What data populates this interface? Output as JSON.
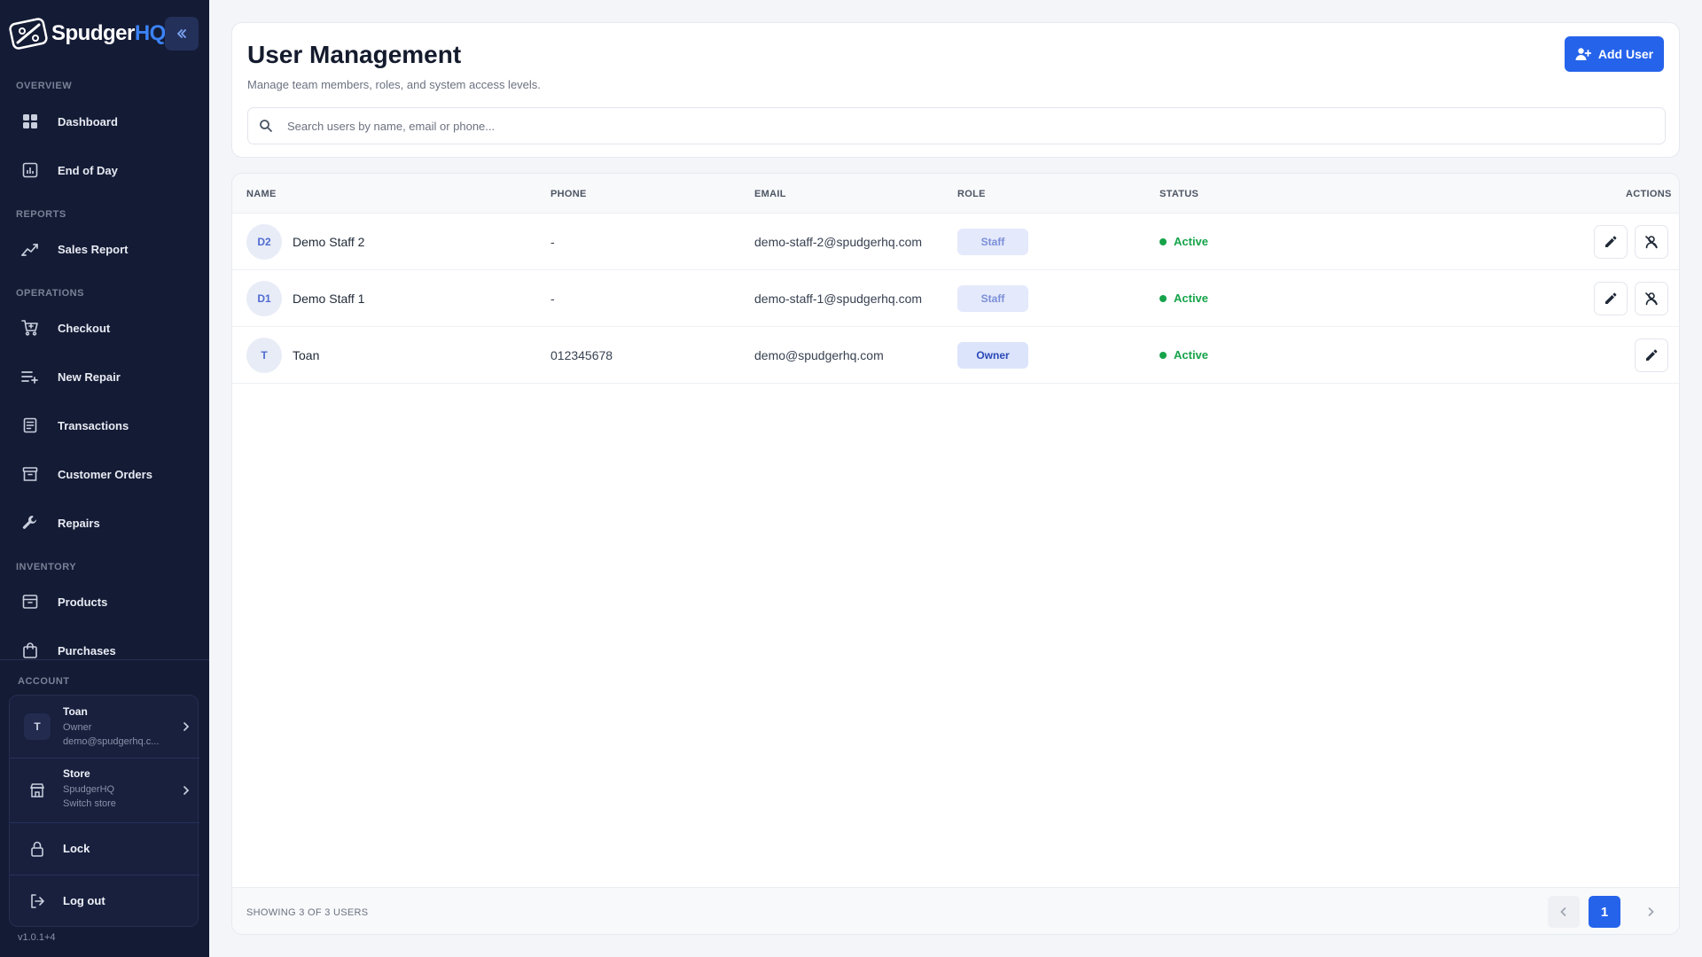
{
  "brand": {
    "name_part1": "Spudger",
    "name_part2": "HQ"
  },
  "sidebar": {
    "sections": {
      "overview": "OVERVIEW",
      "reports": "REPORTS",
      "operations": "OPERATIONS",
      "inventory": "INVENTORY",
      "account": "ACCOUNT"
    },
    "items": [
      {
        "label": "Dashboard",
        "icon": "grid-icon"
      },
      {
        "label": "End of Day",
        "icon": "bar-chart-icon"
      },
      {
        "label": "Sales Report",
        "icon": "trend-icon"
      },
      {
        "label": "Checkout",
        "icon": "cart-icon"
      },
      {
        "label": "New Repair",
        "icon": "list-add-icon"
      },
      {
        "label": "Transactions",
        "icon": "receipt-icon"
      },
      {
        "label": "Customer Orders",
        "icon": "archive-icon"
      },
      {
        "label": "Repairs",
        "icon": "wrench-icon"
      },
      {
        "label": "Products",
        "icon": "box-icon"
      },
      {
        "label": "Purchases",
        "icon": "bag-icon"
      }
    ],
    "account": {
      "user": {
        "initial": "T",
        "name": "Toan",
        "role": "Owner",
        "email": "demo@spudgerhq.c..."
      },
      "store": {
        "name": "Store",
        "store_name": "SpudgerHQ",
        "action": "Switch store"
      },
      "lock_label": "Lock",
      "logout_label": "Log out"
    },
    "version": "v1.0.1+4"
  },
  "header": {
    "title": "User Management",
    "subtitle": "Manage team members, roles, and system access levels.",
    "add_user_label": "Add User",
    "search_placeholder": "Search users by name, email or phone..."
  },
  "table": {
    "columns": {
      "name": "NAME",
      "phone": "PHONE",
      "email": "EMAIL",
      "role": "ROLE",
      "status": "STATUS",
      "actions": "ACTIONS"
    },
    "rows": [
      {
        "initials": "D2",
        "name": "Demo Staff 2",
        "phone": "-",
        "email": "demo-staff-2@spudgerhq.com",
        "role": "Staff",
        "status": "Active"
      },
      {
        "initials": "D1",
        "name": "Demo Staff 1",
        "phone": "-",
        "email": "demo-staff-1@spudgerhq.com",
        "role": "Staff",
        "status": "Active"
      },
      {
        "initials": "T",
        "name": "Toan",
        "phone": "012345678",
        "email": "demo@spudgerhq.com",
        "role": "Owner",
        "status": "Active"
      }
    ],
    "footer": {
      "showing": "SHOWING 3 OF 3 USERS",
      "current_page": "1"
    }
  },
  "colors": {
    "accent": "#2563eb",
    "sidebar_bg": "#141b35",
    "active_green": "#16a34a"
  }
}
